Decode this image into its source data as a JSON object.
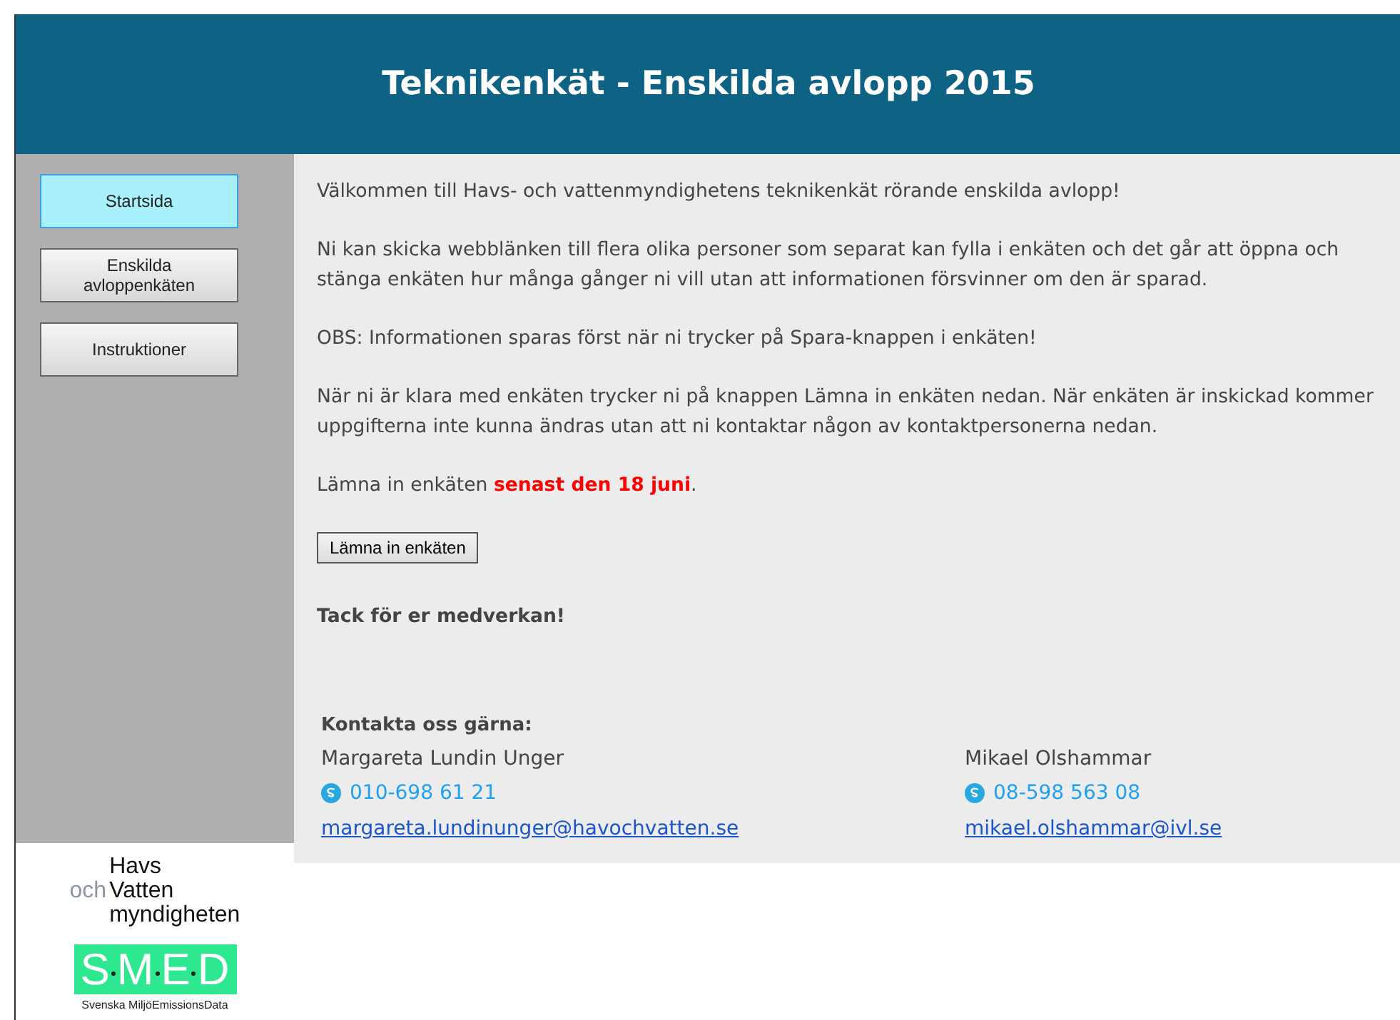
{
  "header": {
    "title": "Teknikenkät - Enskilda avlopp 2015"
  },
  "sidebar": {
    "items": [
      {
        "label": "Startsida",
        "selected": true
      },
      {
        "label": "Enskilda avloppenkäten",
        "selected": false
      },
      {
        "label": "Instruktioner",
        "selected": false
      }
    ]
  },
  "logos": {
    "havs": [
      "Havs",
      "och",
      "Vatten",
      "myndigheten"
    ],
    "smed": "SMED",
    "smed_subtitle": "Svenska MiljöEmissionsData"
  },
  "content": {
    "paragraphs": [
      "Välkommen till Havs- och vattenmyndighetens teknikenkät rörande enskilda avlopp!",
      "Ni kan skicka webblänken till flera olika personer som separat kan fylla i enkäten och det går att öppna och stänga enkäten hur många gånger ni vill utan att informationen försvinner om den är sparad.",
      "OBS: Informationen sparas först när ni trycker på Spara-knappen i enkäten!",
      "När ni är klara med enkäten trycker ni på knappen Lämna in enkäten nedan. När enkäten är inskickad kommer uppgifterna inte kunna ändras utan att ni kontaktar någon av kontaktpersonerna nedan.",
      "Lämna in enkäten **senast den 18 juni**."
    ],
    "submit_button": "Lämna in enkäten",
    "thanks": "Tack för er medverkan!",
    "contact_heading": "Kontakta oss gärna:",
    "contacts": [
      {
        "name": "Margareta Lundin Unger",
        "phone": "010-698 61 21",
        "email": "margareta.lundinunger@havochvatten.se"
      },
      {
        "name": "Mikael Olshammar",
        "phone": "08-598 563 08",
        "email": "mikael.olshammar@ivl.se"
      }
    ]
  }
}
